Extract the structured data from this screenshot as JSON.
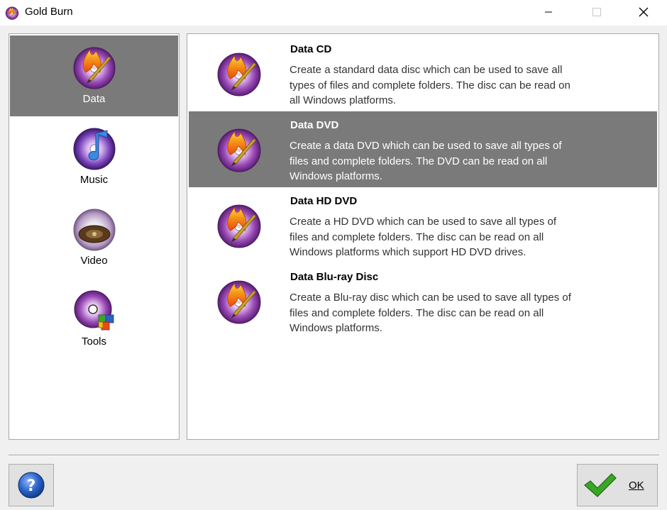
{
  "window": {
    "title": "Gold Burn",
    "minimize_icon": "minimize-icon",
    "maximize_icon": "maximize-icon",
    "close_icon": "close-icon"
  },
  "nav": {
    "items": [
      {
        "label": "Data",
        "icon": "data-disc-icon",
        "selected": true
      },
      {
        "label": "Music",
        "icon": "music-disc-icon",
        "selected": false
      },
      {
        "label": "Video",
        "icon": "video-disc-icon",
        "selected": false
      },
      {
        "label": "Tools",
        "icon": "tools-disc-icon",
        "selected": false
      }
    ]
  },
  "options": [
    {
      "title": "Data CD",
      "description": "Create a standard data disc which can be used to save all types of files and complete folders. The disc can be read on all Windows platforms.",
      "selected": false
    },
    {
      "title": "Data DVD",
      "description": "Create a data DVD which can be used to save all types of files and complete folders. The DVD can be read on all Windows platforms.",
      "selected": true
    },
    {
      "title": "Data HD DVD",
      "description": "Create a HD DVD which can be used to save all types of files and complete folders. The disc can be read on all Windows platforms which support HD DVD drives.",
      "selected": false
    },
    {
      "title": "Data Blu-ray Disc",
      "description": "Create a Blu-ray disc which can be used to save all types of files and complete folders. The disc can be read on all Windows platforms.",
      "selected": false
    }
  ],
  "footer": {
    "help_icon": "help-icon",
    "ok_label": "OK",
    "ok_icon": "checkmark-icon"
  },
  "colors": {
    "selected_bg": "#7a7a7a",
    "disc_purple": "#8b3fa0",
    "flame_orange": "#f08a1c",
    "check_green": "#3aa626",
    "help_blue": "#2a63c8"
  }
}
